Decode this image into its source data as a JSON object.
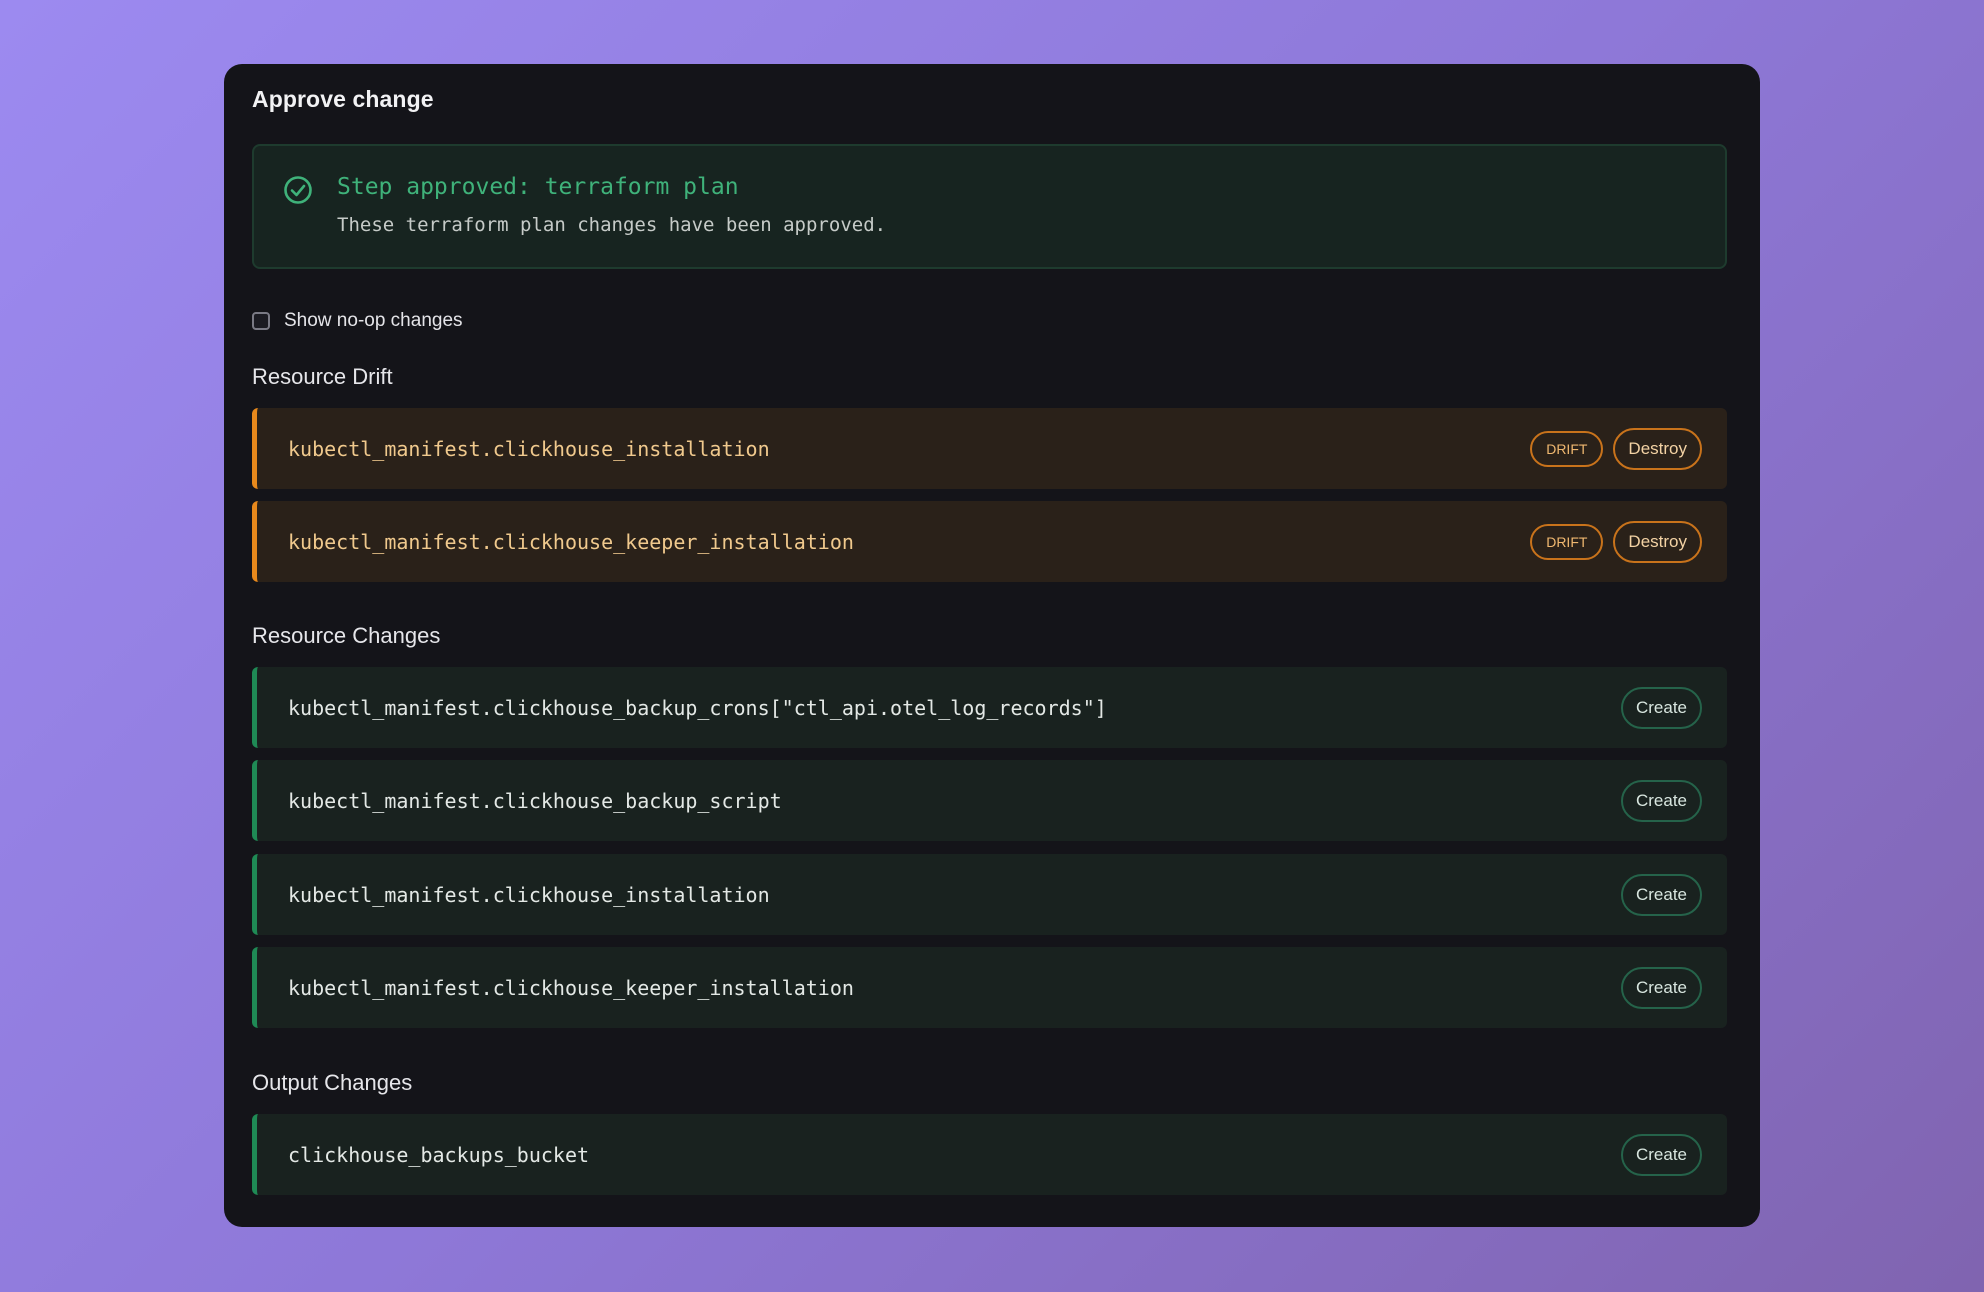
{
  "panel": {
    "title": "Approve change"
  },
  "approval": {
    "title": "Step approved: terraform plan",
    "message": "These terraform plan changes have been approved."
  },
  "noop": {
    "label": "Show no-op changes",
    "checked": false
  },
  "sections": {
    "drift_heading": "Resource Drift",
    "changes_heading": "Resource Changes",
    "outputs_heading": "Output Changes"
  },
  "drift_rows": [
    {
      "name": "kubectl_manifest.clickhouse_installation",
      "tag": "DRIFT",
      "action": "Destroy"
    },
    {
      "name": "kubectl_manifest.clickhouse_keeper_installation",
      "tag": "DRIFT",
      "action": "Destroy"
    }
  ],
  "change_rows": [
    {
      "name": "kubectl_manifest.clickhouse_backup_crons[\"ctl_api.otel_log_records\"]",
      "action": "Create"
    },
    {
      "name": "kubectl_manifest.clickhouse_backup_script",
      "action": "Create"
    },
    {
      "name": "kubectl_manifest.clickhouse_installation",
      "action": "Create"
    },
    {
      "name": "kubectl_manifest.clickhouse_keeper_installation",
      "action": "Create"
    }
  ],
  "output_rows": [
    {
      "name": "clickhouse_backups_bucket",
      "action": "Create"
    }
  ],
  "colors": {
    "drift_accent": "#e8891c",
    "create_accent": "#1f8a55",
    "approved_text": "#3fb27a"
  },
  "icons": {
    "approved": "check-circle-icon"
  }
}
